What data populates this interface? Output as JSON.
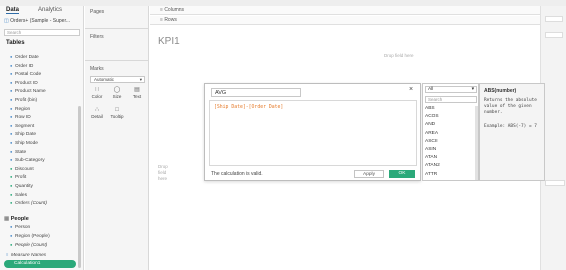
{
  "data_pane": {
    "tab_data": "Data",
    "tab_analytics": "Analytics",
    "datasource": "Orders+ (Sample - Super...",
    "search_placeholder": "Search",
    "tables_heading": "Tables",
    "fields": [
      {
        "label": "Order Date",
        "kind": "dim"
      },
      {
        "label": "Order ID",
        "kind": "dim"
      },
      {
        "label": "Postal Code",
        "kind": "dim"
      },
      {
        "label": "Product ID",
        "kind": "dim"
      },
      {
        "label": "Product Name",
        "kind": "dim"
      },
      {
        "label": "Profit (bin)",
        "kind": "dim"
      },
      {
        "label": "Region",
        "kind": "dim"
      },
      {
        "label": "Row ID",
        "kind": "dim"
      },
      {
        "label": "Segment",
        "kind": "dim"
      },
      {
        "label": "Ship Date",
        "kind": "dim"
      },
      {
        "label": "Ship Mode",
        "kind": "dim"
      },
      {
        "label": "State",
        "kind": "dim"
      },
      {
        "label": "Sub-Category",
        "kind": "dim"
      },
      {
        "label": "Discount",
        "kind": "measure"
      },
      {
        "label": "Profit",
        "kind": "measure"
      },
      {
        "label": "Quantity",
        "kind": "measure"
      },
      {
        "label": "Sales",
        "kind": "measure"
      },
      {
        "label": "Orders (Count)",
        "kind": "measure-italic"
      }
    ],
    "people_heading": "People",
    "people_fields": [
      "Person",
      "Region (People)",
      "People (Count)"
    ],
    "measure_names": "Measure Names",
    "calc_pill": "Calculation1"
  },
  "cards": {
    "pages": "Pages",
    "filters": "Filters",
    "marks": "Marks",
    "marks_type": "Automatic",
    "buttons": [
      "Color",
      "Size",
      "Text",
      "Detail",
      "Tooltip"
    ]
  },
  "shelves": {
    "columns": "Columns",
    "rows": "Rows"
  },
  "sheet": {
    "title": "KPI1",
    "drop_field_here": "Drop field here",
    "drop_field_side": "Drop field here"
  },
  "calc_dialog": {
    "name": "AVG",
    "formula": "[Ship Date]-[Order Date]",
    "status": "The calculation is valid.",
    "apply": "Apply",
    "ok": "OK"
  },
  "functions": {
    "category": "All",
    "search_placeholder": "Search",
    "items": [
      "ABS",
      "ACOS",
      "AND",
      "AREA",
      "ASCII",
      "ASIN",
      "ATAN",
      "ATAN2",
      "ATTR"
    ]
  },
  "help": {
    "title": "ABS(number)",
    "description": "Returns the absolute value of the given number.",
    "example": "Example: ABS(-7) = 7"
  },
  "colors": {
    "accent_green": "#2ba97a",
    "formula_orange": "#e57a2a"
  }
}
